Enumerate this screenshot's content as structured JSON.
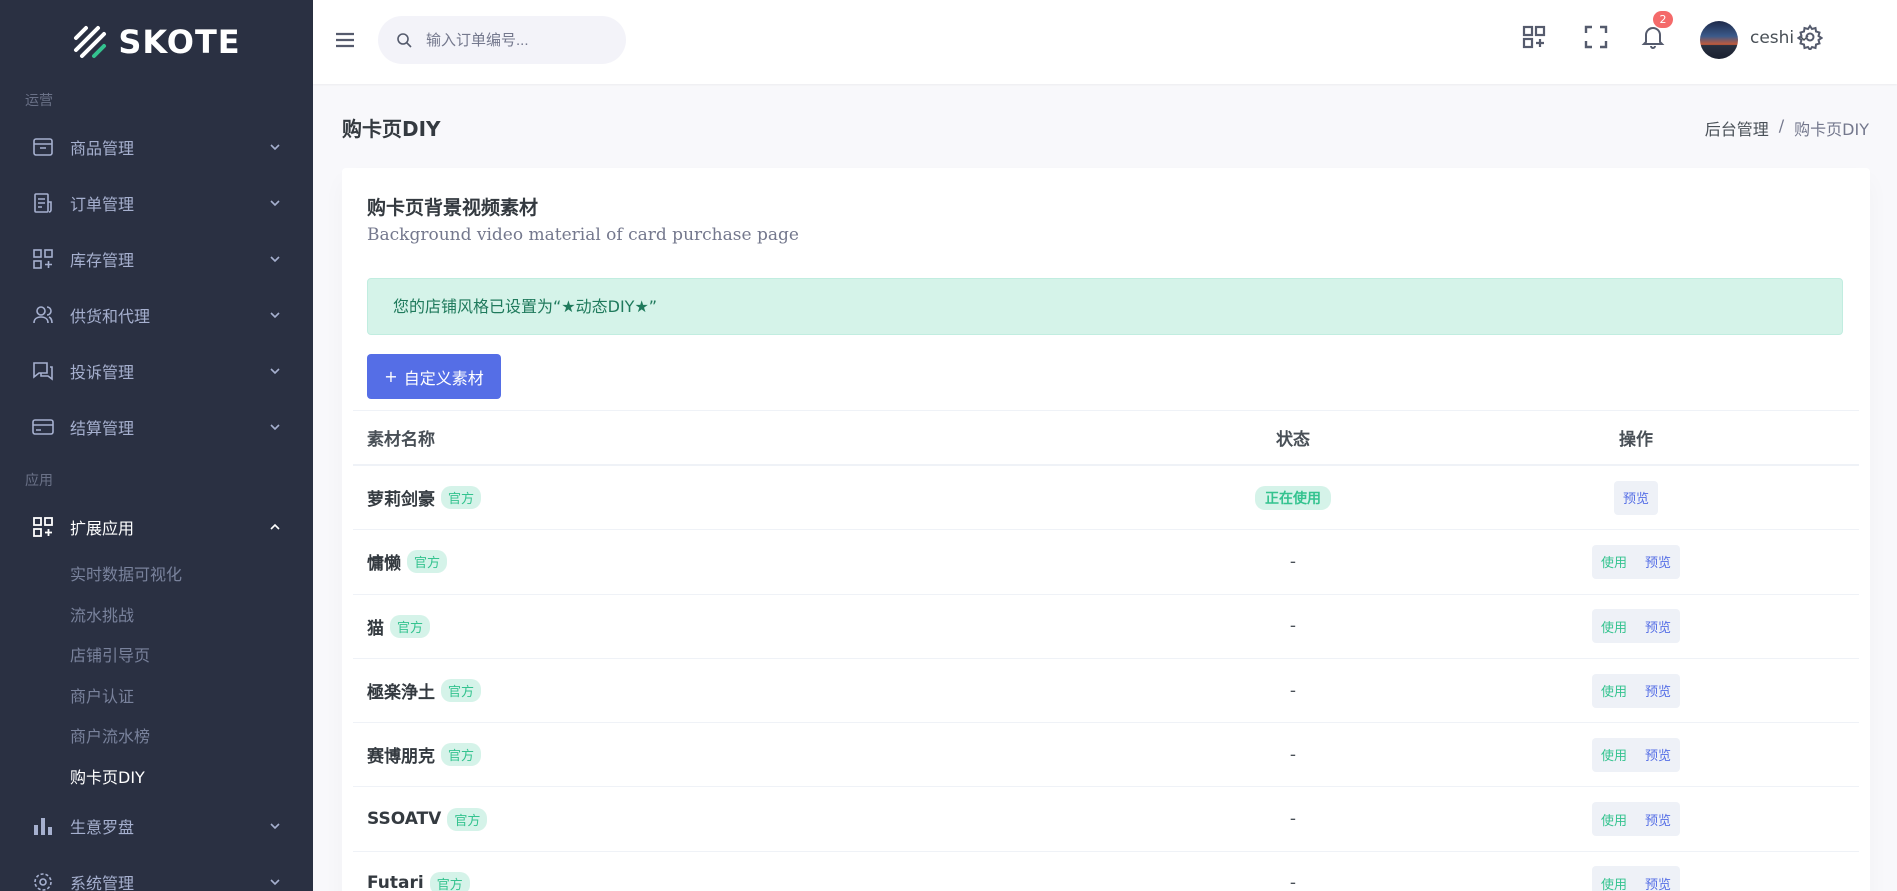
{
  "brand": {
    "name": "SKOTE"
  },
  "sidebar": {
    "section_ops": "运营",
    "section_apps": "应用",
    "items": [
      {
        "label": "商品管理",
        "icon": "box-icon"
      },
      {
        "label": "订单管理",
        "icon": "order-icon"
      },
      {
        "label": "库存管理",
        "icon": "grid-plus-icon"
      },
      {
        "label": "供货和代理",
        "icon": "users-icon"
      },
      {
        "label": "投诉管理",
        "icon": "chat-icon"
      },
      {
        "label": "结算管理",
        "icon": "card-icon"
      }
    ],
    "expanded": {
      "label": "扩展应用",
      "icon": "grid-plus-icon"
    },
    "subitems": [
      "实时数据可视化",
      "流水挑战",
      "店铺引导页",
      "商户认证",
      "商户流水榜",
      "购卡页DIY"
    ],
    "after": [
      {
        "label": "生意罗盘",
        "icon": "bar-chart-icon"
      },
      {
        "label": "系统管理",
        "icon": "gear-icon"
      }
    ]
  },
  "topbar": {
    "search_placeholder": "输入订单编号...",
    "notification_count": "2",
    "username": "ceshi"
  },
  "page": {
    "title": "购卡页DIY",
    "breadcrumb": [
      "后台管理",
      "/",
      "购卡页DIY"
    ]
  },
  "card": {
    "title": "购卡页背景视频素材",
    "subtitle": "Background video material of card purchase page",
    "alert": "您的店铺风格已设置为“★动态DIY★”",
    "add_button": "自定义素材",
    "add_icon": "+"
  },
  "table": {
    "headers": [
      "素材名称",
      "状态",
      "操作"
    ],
    "official_tag": "官方",
    "active_status": "正在使用",
    "empty_status": "-",
    "use_label": "使用",
    "preview_label": "预览",
    "rows": [
      {
        "name": "萝莉剑豪"
      },
      {
        "name": "慵懒"
      },
      {
        "name": "猫"
      },
      {
        "name": "極楽浄土"
      },
      {
        "name": "赛博朋克"
      },
      {
        "name": "SSOATV"
      },
      {
        "name": "Futari"
      }
    ]
  }
}
